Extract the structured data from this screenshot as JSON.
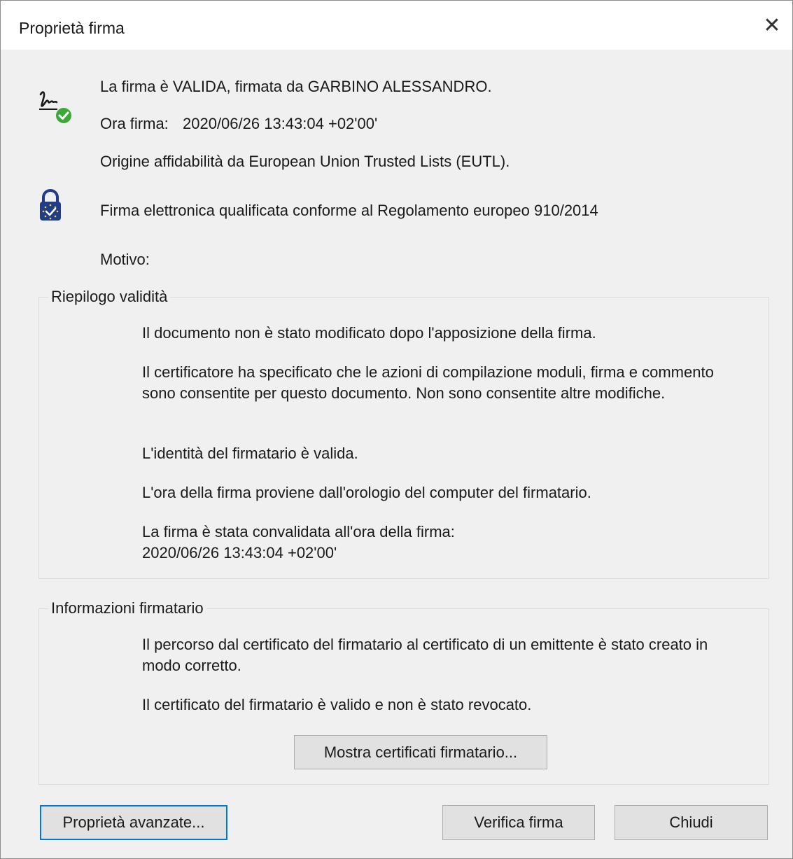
{
  "window": {
    "title": "Proprietà firma",
    "close_glyph": "✕"
  },
  "header": {
    "signature_status": "La firma è VALIDA, firmata da GARBINO ALESSANDRO.",
    "signing_time_label": "Ora firma:",
    "signing_time_value": "2020/06/26 13:43:04 +02'00'",
    "trust_source": "Origine affidabilità da European Union Trusted Lists (EUTL).",
    "qualified_signature": "Firma elettronica qualificata conforme al Regolamento europeo 910/2014",
    "reason_label": "Motivo:",
    "signature_icon": "signature-valid-icon",
    "eu_lock_icon": "eu-trust-lock-icon"
  },
  "validity_summary": {
    "label": "Riepilogo validità",
    "items": [
      "Il documento non è stato modificato dopo l'apposizione della firma.",
      "Il certificatore ha specificato che le azioni di compilazione moduli, firma e commento sono consentite per questo documento. Non sono consentite altre modifiche.",
      "L'identità del firmatario è valida.",
      "L'ora della firma proviene dall'orologio del computer del firmatario.",
      "La firma è stata convalidata all'ora della firma:"
    ],
    "validated_time": "2020/06/26 13:43:04 +02'00'"
  },
  "signer_info": {
    "label": "Informazioni firmatario",
    "items": [
      "Il percorso dal certificato del firmatario al certificato di un emittente è stato creato in modo corretto.",
      "Il certificato del firmatario è valido e non è stato revocato."
    ],
    "show_certificates_button": "Mostra certificati firmatario..."
  },
  "footer": {
    "advanced_button": "Proprietà avanzate...",
    "verify_button": "Verifica firma",
    "close_button": "Chiudi"
  },
  "colors": {
    "check_green": "#3aa935",
    "lock_blue": "#1f3d8a",
    "focus_blue": "#0078d7"
  }
}
